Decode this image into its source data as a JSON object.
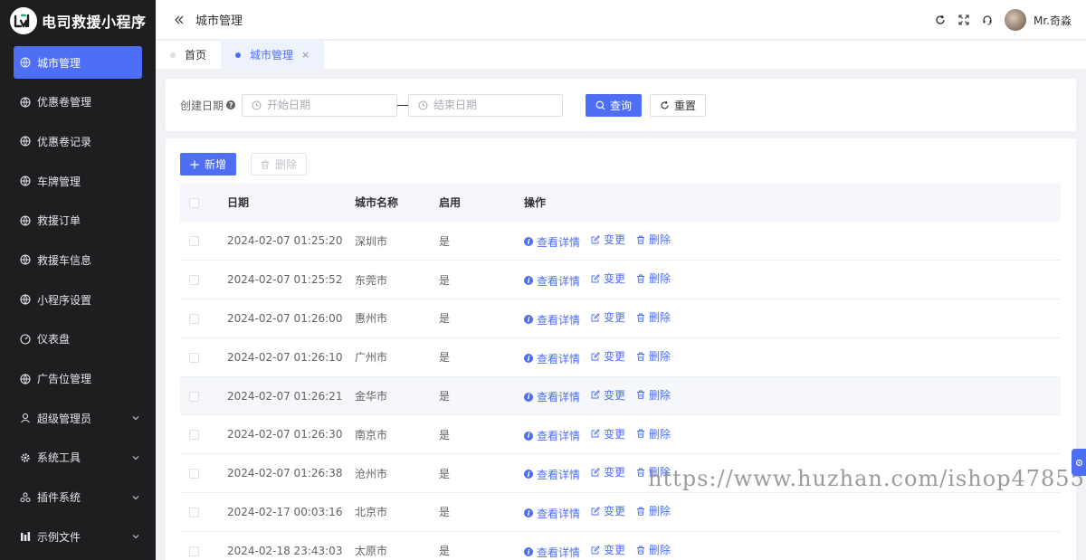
{
  "app": {
    "name": "电司救援小程序"
  },
  "sidebar": {
    "items": [
      {
        "label": "城市管理",
        "icon": "globe-icon",
        "active": true,
        "has_children": false
      },
      {
        "label": "优惠卷管理",
        "icon": "globe-icon",
        "active": false,
        "has_children": false
      },
      {
        "label": "优惠卷记录",
        "icon": "globe-icon",
        "active": false,
        "has_children": false
      },
      {
        "label": "车牌管理",
        "icon": "globe-icon",
        "active": false,
        "has_children": false
      },
      {
        "label": "救援订单",
        "icon": "globe-icon",
        "active": false,
        "has_children": false
      },
      {
        "label": "救援车信息",
        "icon": "globe-icon",
        "active": false,
        "has_children": false
      },
      {
        "label": "小程序设置",
        "icon": "globe-icon",
        "active": false,
        "has_children": false
      },
      {
        "label": "仪表盘",
        "icon": "dashboard-icon",
        "active": false,
        "has_children": false
      },
      {
        "label": "广告位管理",
        "icon": "globe-icon",
        "active": false,
        "has_children": false
      },
      {
        "label": "超级管理员",
        "icon": "user-icon",
        "active": false,
        "has_children": true
      },
      {
        "label": "系统工具",
        "icon": "gear-icon",
        "active": false,
        "has_children": true
      },
      {
        "label": "插件系统",
        "icon": "plugin-icon",
        "active": false,
        "has_children": true
      },
      {
        "label": "示例文件",
        "icon": "chart-icon",
        "active": false,
        "has_children": true
      }
    ]
  },
  "header": {
    "title": "城市管理",
    "username": "Mr.奇淼"
  },
  "tabs": [
    {
      "label": "首页",
      "active": false
    },
    {
      "label": "城市管理",
      "active": true,
      "close": "×"
    }
  ],
  "search": {
    "label": "创建日期",
    "start_placeholder": "开始日期",
    "end_placeholder": "结束日期",
    "query_label": "查询",
    "reset_label": "重置"
  },
  "toolbar": {
    "add_label": "新增",
    "delete_label": "删除"
  },
  "table": {
    "headers": {
      "date": "日期",
      "city": "城市名称",
      "enabled": "启用",
      "actions": "操作"
    },
    "action_labels": {
      "view": "查看详情",
      "edit": "变更",
      "delete": "删除"
    },
    "rows": [
      {
        "date": "2024-02-07 01:25:20",
        "city": "深圳市",
        "enabled": "是"
      },
      {
        "date": "2024-02-07 01:25:52",
        "city": "东莞市",
        "enabled": "是"
      },
      {
        "date": "2024-02-07 01:26:00",
        "city": "惠州市",
        "enabled": "是"
      },
      {
        "date": "2024-02-07 01:26:10",
        "city": "广州市",
        "enabled": "是"
      },
      {
        "date": "2024-02-07 01:26:21",
        "city": "金华市",
        "enabled": "是"
      },
      {
        "date": "2024-02-07 01:26:30",
        "city": "南京市",
        "enabled": "是"
      },
      {
        "date": "2024-02-07 01:26:38",
        "city": "沧州市",
        "enabled": "是"
      },
      {
        "date": "2024-02-17 00:03:16",
        "city": "北京市",
        "enabled": "是"
      },
      {
        "date": "2024-02-18 23:43:03",
        "city": "太原市",
        "enabled": "是"
      }
    ]
  },
  "watermark": "https://www.huzhan.com/ishop47855",
  "colors": {
    "primary": "#4d6ef5",
    "sidebar_bg": "#1d1e1f"
  }
}
